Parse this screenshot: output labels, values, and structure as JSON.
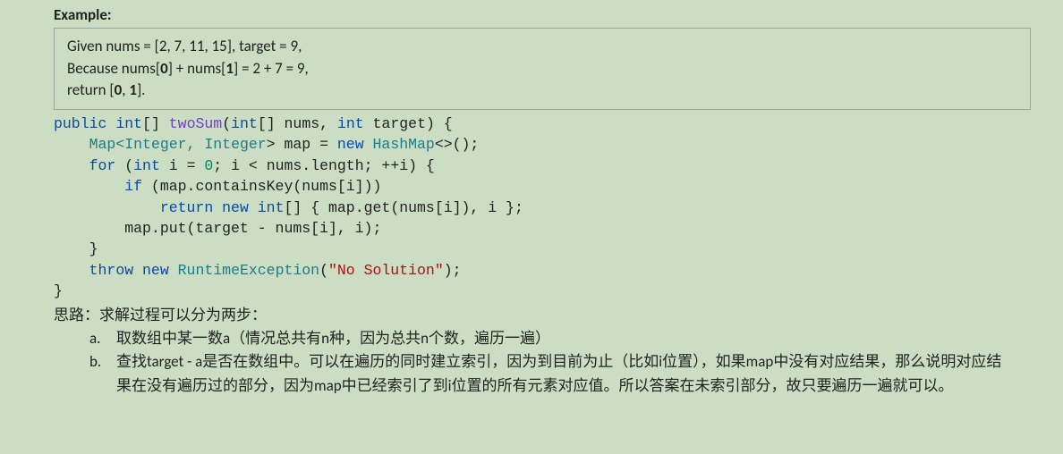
{
  "example": {
    "label": "Example:",
    "line1_a": "Given nums = [2, 7, 11, 15], target = 9,",
    "line2_a": "Because nums[",
    "line2_b": "0",
    "line2_c": "] + nums[",
    "line2_d": "1",
    "line2_e": "] = 2 + 7 = 9,",
    "line3_a": "return [",
    "line3_b": "0",
    "line3_c": ", ",
    "line3_d": "1",
    "line3_e": "]."
  },
  "code": {
    "l1": {
      "t1": "public",
      "t2": " ",
      "t3": "int",
      "t4": "[] ",
      "t5": "twoSum",
      "t6": "(",
      "t7": "int",
      "t8": "[] nums, ",
      "t9": "int",
      "t10": " target) {"
    },
    "l2": {
      "t1": "    ",
      "t2": "Map",
      "t3": "<",
      "t4": "Integer",
      "t5": ", ",
      "t6": "Integer",
      "t7": "> map = ",
      "t8": "new",
      "t9": " ",
      "t10": "HashMap",
      "t11": "<>();"
    },
    "l3": {
      "t1": "    ",
      "t2": "for",
      "t3": " (",
      "t4": "int",
      "t5": " i = ",
      "t6": "0",
      "t7": "; i < nums.length; ++i) {"
    },
    "l4": {
      "t1": "        ",
      "t2": "if",
      "t3": " (map.containsKey(nums[i]))"
    },
    "l5": {
      "t1": "            ",
      "t2": "return",
      "t3": " ",
      "t4": "new",
      "t5": " ",
      "t6": "int",
      "t7": "[] { map.get(nums[i]), i };"
    },
    "l6": {
      "t1": "        map.put(target - nums[i], i);"
    },
    "l7": {
      "t1": "    }"
    },
    "l8": {
      "t1": "    ",
      "t2": "throw",
      "t3": " ",
      "t4": "new",
      "t5": " ",
      "t6": "RuntimeException",
      "t7": "(",
      "t8": "\"No Solution\"",
      "t9": ");"
    },
    "l9": {
      "t1": "}"
    }
  },
  "explain": {
    "head": "思路：求解过程可以分为两步：",
    "a_marker": "a.",
    "a_text": "取数组中某一数a（情况总共有n种，因为总共n个数，遍历一遍）",
    "b_marker": "b.",
    "b_text": "查找target - a是否在数组中。可以在遍历的同时建立索引，因为到目前为止（比如i位置），如果map中没有对应结果，那么说明对应结果在没有遍历过的部分，因为map中已经索引了到i位置的所有元素对应值。所以答案在未索引部分，故只要遍历一遍就可以。"
  }
}
